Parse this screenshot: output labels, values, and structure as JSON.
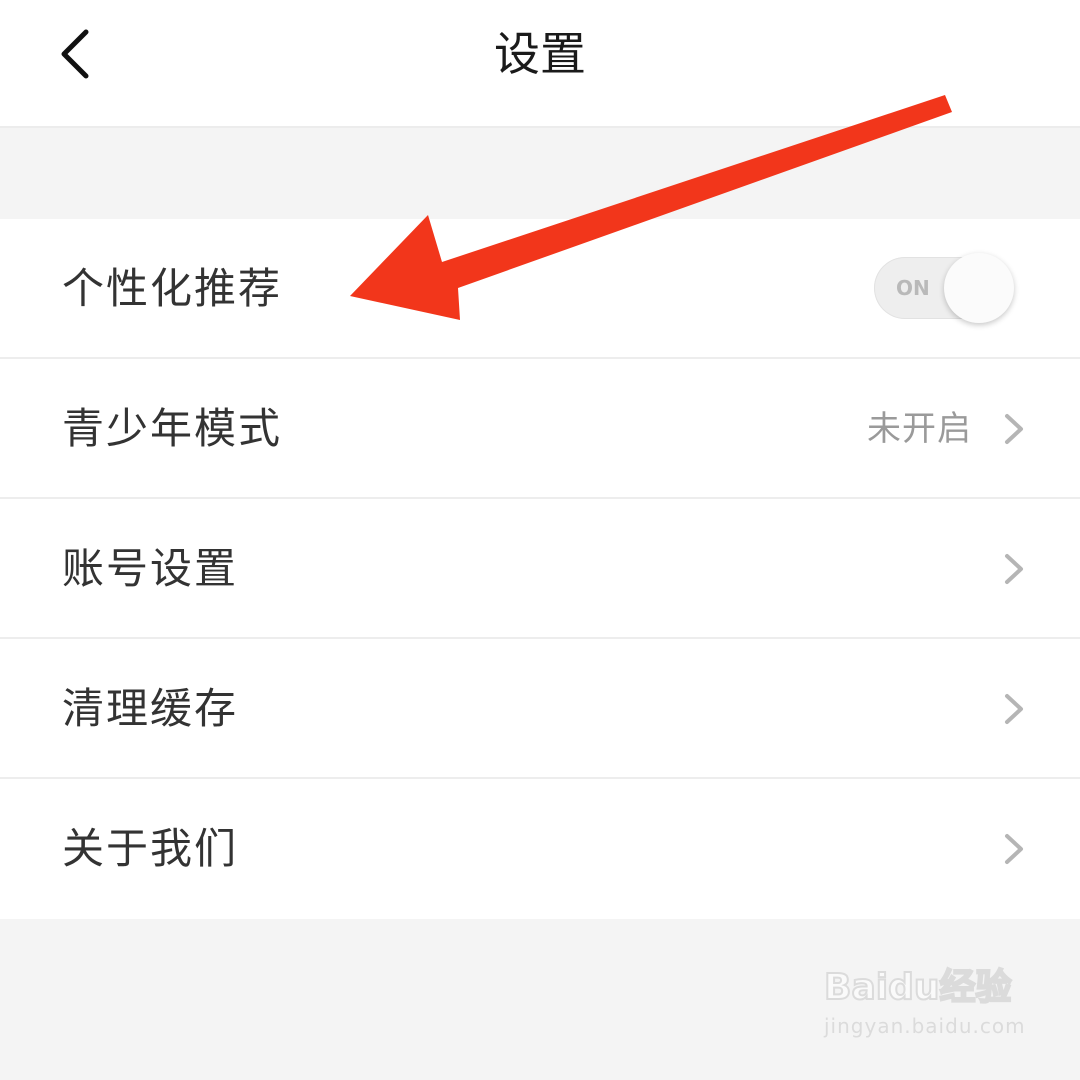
{
  "header": {
    "title": "设置"
  },
  "settings": {
    "items": [
      {
        "label": "个性化推荐",
        "control": "toggle",
        "toggle_text": "ON",
        "toggle_on": true
      },
      {
        "label": "青少年模式",
        "value": "未开启"
      },
      {
        "label": "账号设置"
      },
      {
        "label": "清理缓存"
      },
      {
        "label": "关于我们"
      }
    ]
  },
  "annotation": {
    "arrow_color": "#f2361b"
  },
  "watermark": {
    "logo_text": "Baidu经验",
    "url_text": "jingyan.baidu.com"
  },
  "colors": {
    "background": "#f4f4f4",
    "surface": "#ffffff",
    "text_primary": "#333333",
    "text_secondary": "#9a9a9a"
  }
}
